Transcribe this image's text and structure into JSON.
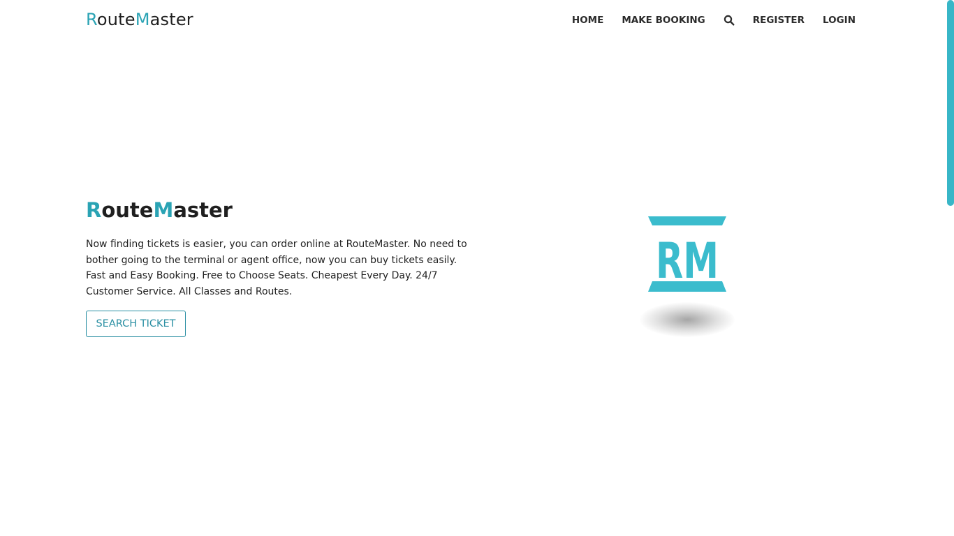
{
  "navbar": {
    "brand": {
      "r": "R",
      "oute": "oute",
      "m": "M",
      "aster": "aster"
    },
    "links": {
      "home": "HOME",
      "make_booking": "MAKE BOOKING",
      "register": "REGISTER",
      "login": "LOGIN"
    },
    "search_icon": "search-icon"
  },
  "hero": {
    "title": {
      "r": "R",
      "oute": "oute",
      "m": "M",
      "aster": "aster"
    },
    "description": "Now finding tickets is easier, you can order online at RouteMaster. No need to bother going to the terminal or agent office, now you can buy tickets easily. Fast and Easy Booking. Free to Choose Seats. Cheapest Every Day. 24/7 Customer Service. All Classes and Routes.",
    "cta_label": "SEARCH TICKET"
  },
  "logo": {
    "text": "RM",
    "icon": "rm-logo"
  },
  "colors": {
    "accent": "#2aa3b4",
    "logo": "#3bbccd",
    "button_border": "#2a8fa3",
    "scrollbar": "#38b6c7"
  }
}
